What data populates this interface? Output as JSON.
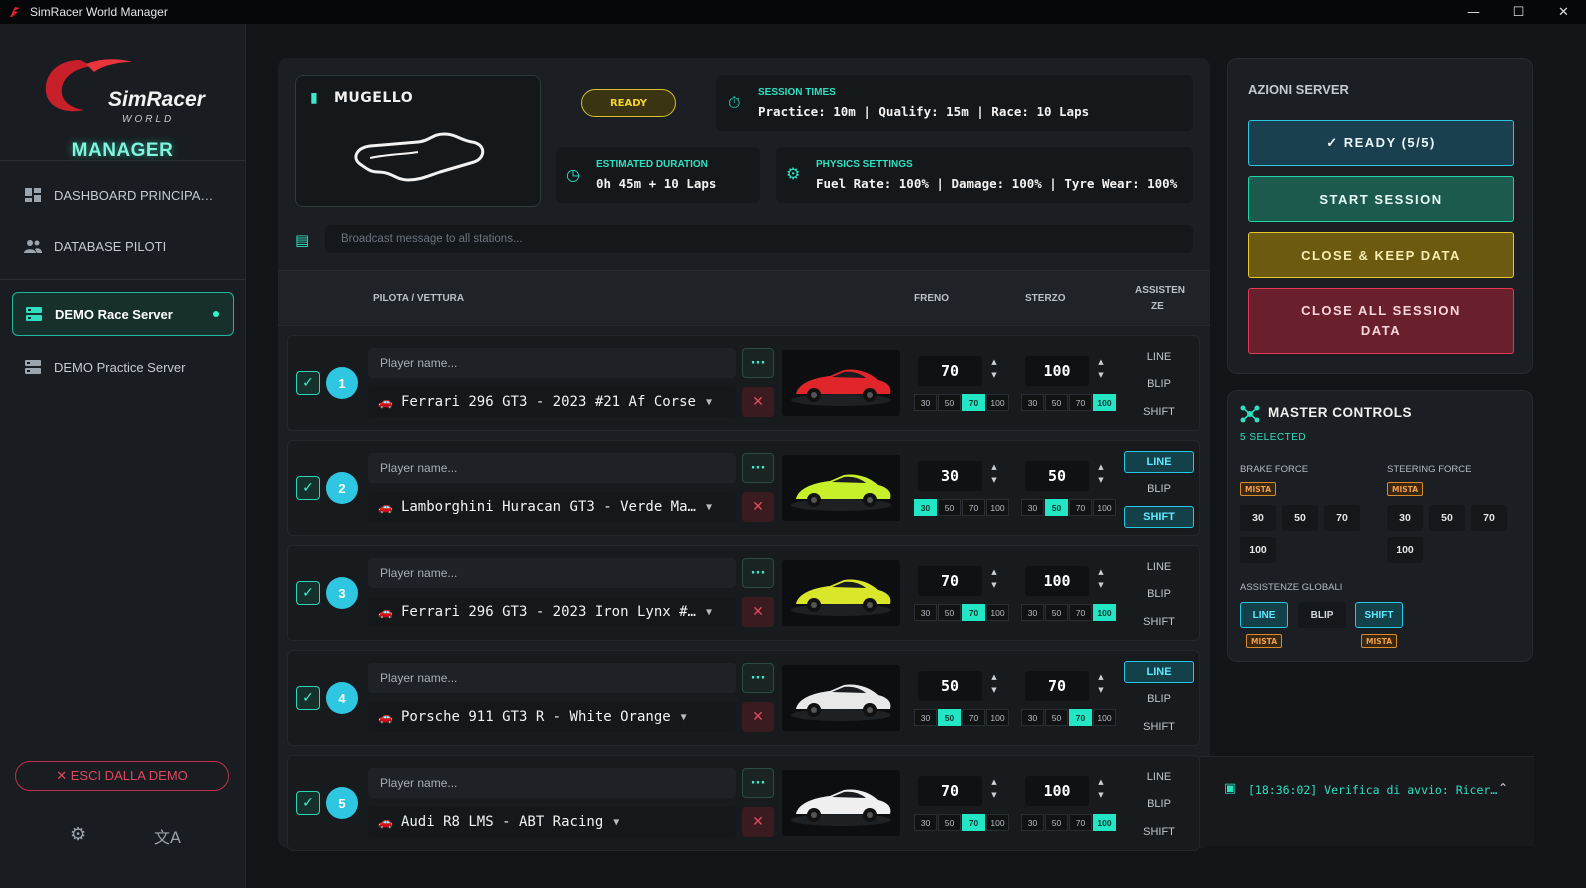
{
  "window": {
    "title": "SimRacer World Manager",
    "min": "—",
    "max": "☐",
    "close": "✕"
  },
  "brand": {
    "line1": "SimRacer",
    "line2": "WORLD",
    "manager": "MANAGER"
  },
  "nav": [
    {
      "label": "DASHBOARD PRINCIPA…"
    },
    {
      "label": "DATABASE PILOTI"
    },
    {
      "label": "DEMO Race Server"
    },
    {
      "label": "DEMO Practice Server"
    }
  ],
  "exit_label": "✕  ESCI DALLA DEMO",
  "track": {
    "name": "MUGELLO"
  },
  "status": "READY",
  "session_times": {
    "label": "SESSION TIMES",
    "value": "Practice: 10m | Qualify: 15m | Race: 10 Laps"
  },
  "estimated": {
    "label": "ESTIMATED DURATION",
    "value": "0h 45m + 10 Laps"
  },
  "physics": {
    "label": "PHYSICS SETTINGS",
    "value": "Fuel Rate: 100% | Damage: 100% | Tyre Wear: 100%"
  },
  "broadcast_placeholder": "Broadcast message to all stations...",
  "columns": {
    "driver": "PILOTA / VETTURA",
    "brake": "FRENO",
    "steer": "STERZO",
    "assist1": "ASSISTEN",
    "assist2": "ZE"
  },
  "preset_values": [
    "30",
    "50",
    "70",
    "100"
  ],
  "rows": [
    {
      "num": "1",
      "placeholder": "Player name...",
      "car": "Ferrari 296 GT3 - 2023 #21 Af Corse",
      "brake": "70",
      "brake_sel": 2,
      "steer": "100",
      "steer_sel": 3,
      "line": false,
      "blip": false,
      "shift": false,
      "color": "#e0262b"
    },
    {
      "num": "2",
      "placeholder": "Player name...",
      "car": "Lamborghini Huracan GT3 - Verde Ma…",
      "brake": "30",
      "brake_sel": 0,
      "steer": "50",
      "steer_sel": 1,
      "line": true,
      "blip": false,
      "shift": true,
      "color": "#c8f02a"
    },
    {
      "num": "3",
      "placeholder": "Player name...",
      "car": "Ferrari 296 GT3 - 2023 Iron Lynx #…",
      "brake": "70",
      "brake_sel": 2,
      "steer": "100",
      "steer_sel": 3,
      "line": false,
      "blip": false,
      "shift": false,
      "color": "#d9e62a"
    },
    {
      "num": "4",
      "placeholder": "Player name...",
      "car": "Porsche 911 GT3 R - White Orange",
      "brake": "50",
      "brake_sel": 1,
      "steer": "70",
      "steer_sel": 2,
      "line": true,
      "blip": false,
      "shift": false,
      "color": "#e8e8e8"
    },
    {
      "num": "5",
      "placeholder": "Player name...",
      "car": "Audi R8 LMS - ABT Racing",
      "brake": "70",
      "brake_sel": 2,
      "steer": "100",
      "steer_sel": 3,
      "line": false,
      "blip": false,
      "shift": false,
      "color": "#f0f0f0"
    }
  ],
  "assist_labels": {
    "line": "LINE",
    "blip": "BLIP",
    "shift": "SHIFT"
  },
  "server": {
    "title": "AZIONI SERVER",
    "ready": "✓ READY (5/5)",
    "start": "START SESSION",
    "close_keep": "CLOSE & KEEP DATA",
    "close_all": "CLOSE ALL SESSION DATA"
  },
  "master": {
    "title": "MASTER CONTROLS",
    "selected": "5 SELECTED",
    "brake_force": "BRAKE FORCE",
    "steering_force": "STEERING FORCE",
    "mista": "MISTA",
    "global": "ASSISTENZE GLOBALI"
  },
  "log": "[18:36:02] Verifica di avvio: Ricer…",
  "colors": {
    "accent": "#2fe0c0",
    "ready": "#f3d530",
    "danger": "#e0485f"
  }
}
